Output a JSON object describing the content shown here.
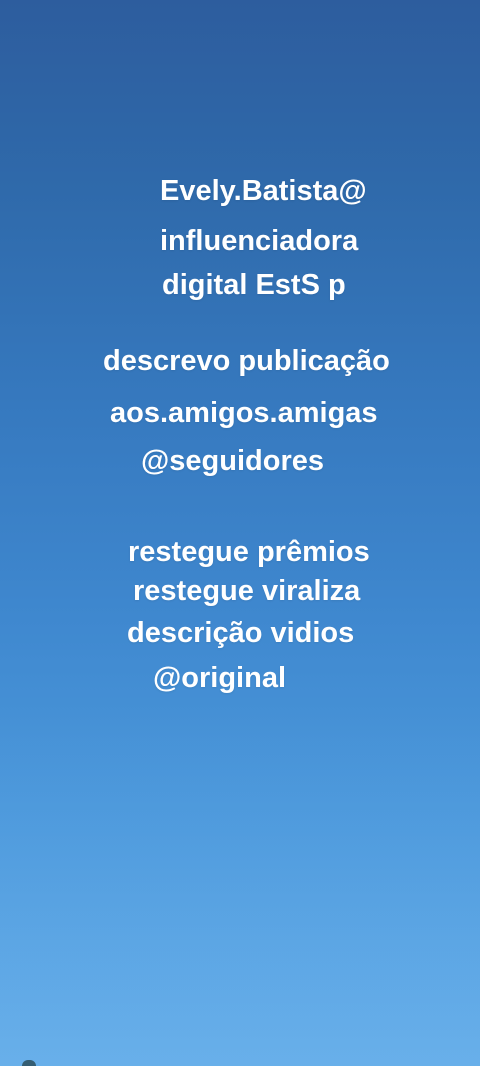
{
  "block1": {
    "line1": "Evely.Batista@",
    "line2": "influenciadora",
    "line3": "digital  EstS p"
  },
  "block2": {
    "line1": "descrevo publicação",
    "line2": "aos.amigos.amigas",
    "line3": "@seguidores"
  },
  "block3": {
    "line1": "restegue prêmios",
    "line2": "restegue viraliza",
    "line3": "descrição vidios",
    "line4": "@original"
  },
  "colors": {
    "text": "#ffffff",
    "sky_top": "#2d5d9e",
    "sky_bottom": "#63aee8"
  }
}
